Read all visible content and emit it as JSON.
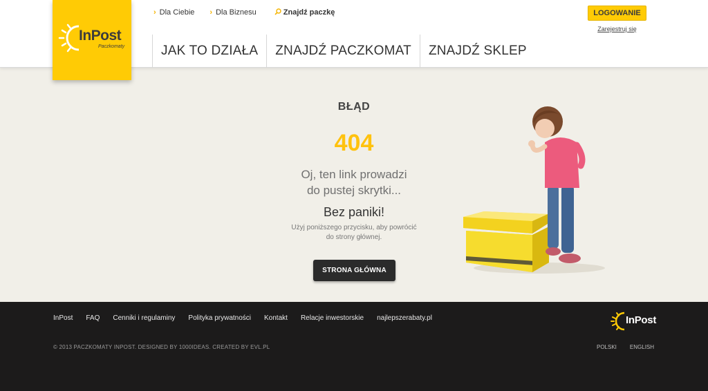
{
  "brand": {
    "name": "InPost",
    "tagline": "Paczkomaty",
    "accent_color": "#ffcb05"
  },
  "header": {
    "top_links": [
      {
        "label": "Dla Ciebie",
        "icon": "chevron-right-icon"
      },
      {
        "label": "Dla Biznesu",
        "icon": "chevron-right-icon"
      }
    ],
    "find_link": {
      "label": "Znajdź paczkę",
      "icon": "search-icon"
    },
    "nav": [
      {
        "label": "JAK TO DZIAŁA"
      },
      {
        "label": "ZNAJDŹ PACZKOMAT"
      },
      {
        "label": "ZNAJDŹ SKLEP"
      }
    ],
    "login_label": "LOGOWANIE",
    "register_label": "Zarejestruj się"
  },
  "error": {
    "title": "BŁĄD",
    "code": "404",
    "message_line1": "Oj, ten link prowadzi",
    "message_line2": "do pustej skrytki...",
    "calm": "Bez paniki!",
    "hint_line1": "Użyj poniższego przycisku, aby powrócić",
    "hint_line2": "do strony głównej.",
    "home_button": "STRONA GŁÓWNA"
  },
  "footer": {
    "links": [
      "InPost",
      "FAQ",
      "Cenniki i regulaminy",
      "Polityka prywatności",
      "Kontakt",
      "Relacje inwestorskie",
      "najlepszerabaty.pl"
    ],
    "copyright": "© 2013 PACZKOMATY INPOST. DESIGNED BY 1000IDEAS. CREATED BY EVL.PL",
    "languages": [
      "POLSKI",
      "ENGLISH"
    ],
    "logo_text": "InPost"
  }
}
